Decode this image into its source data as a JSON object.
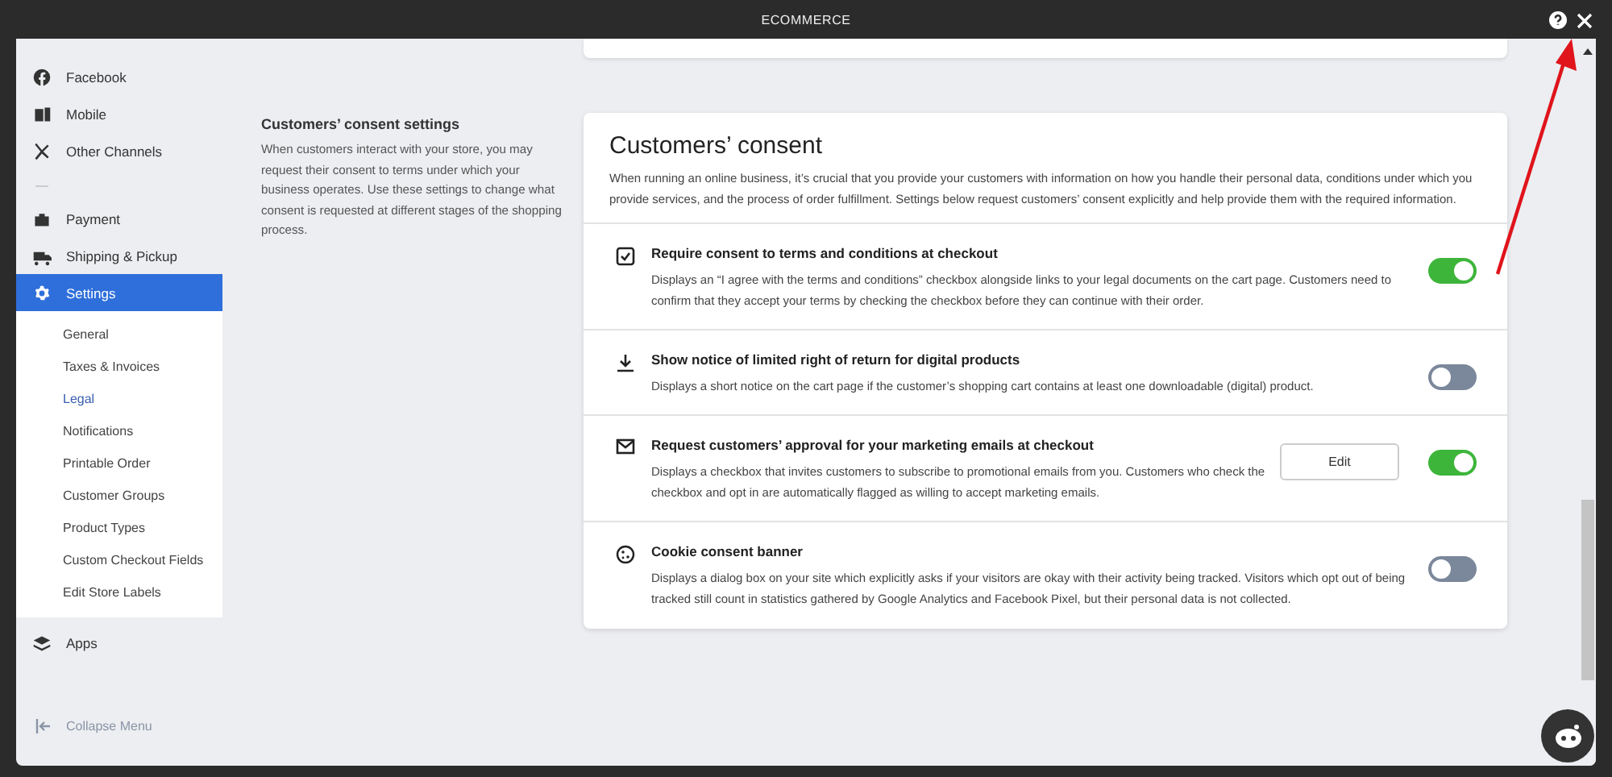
{
  "window": {
    "title": "ECOMMERCE"
  },
  "sidebar": {
    "groups": [
      {
        "items": [
          {
            "label": "Facebook",
            "selected": false
          },
          {
            "label": "Mobile",
            "selected": false
          },
          {
            "label": "Other Channels",
            "selected": false
          }
        ]
      },
      {
        "items": [
          {
            "label": "Payment",
            "selected": false
          },
          {
            "label": "Shipping & Pickup",
            "selected": false
          },
          {
            "label": "Settings",
            "selected": true
          }
        ]
      }
    ],
    "submenu": [
      {
        "label": "General",
        "selected": false
      },
      {
        "label": "Taxes & Invoices",
        "selected": false
      },
      {
        "label": "Legal",
        "selected": true
      },
      {
        "label": "Notifications",
        "selected": false
      },
      {
        "label": "Printable Order",
        "selected": false
      },
      {
        "label": "Customer Groups",
        "selected": false
      },
      {
        "label": "Product Types",
        "selected": false
      },
      {
        "label": "Custom Checkout Fields",
        "selected": false
      },
      {
        "label": "Edit Store Labels",
        "selected": false
      }
    ],
    "bottom_items": [
      {
        "label": "Apps",
        "selected": false
      }
    ],
    "collapse": "Collapse Menu"
  },
  "section": {
    "heading": "Customers’ consent settings",
    "description": "When customers interact with your store, you may request their consent to terms under which your business operates. Use these settings to change what consent is requested at different stages of the shopping process."
  },
  "card": {
    "title": "Customers’ consent",
    "description": "When running an online business, it’s crucial that you provide your customers with information on how you handle their personal data, conditions under which you provide services, and the process of order fulfillment. Settings below request customers’ consent explicitly and help provide them with the required information.",
    "rows": [
      {
        "title": "Require consent to terms and conditions at checkout",
        "description": "Displays an “I agree with the terms and conditions” checkbox alongside links to your legal documents on the cart page. Customers need to confirm that they accept your terms by checking the checkbox before they can continue with their order.",
        "on": true
      },
      {
        "title": "Show notice of limited right of return for digital products",
        "description": "Displays a short notice on the cart page if the customer’s shopping cart contains at least one downloadable (digital) product.",
        "on": false
      },
      {
        "title": "Request customers’ approval for your marketing emails at checkout",
        "description": "Displays a checkbox that invites customers to subscribe to promotional emails from you. Customers who check the checkbox and opt in are automatically flagged as willing to accept marketing emails.",
        "on": true,
        "button": "Edit"
      },
      {
        "title": "Cookie consent banner",
        "description": "Displays a dialog box on your site which explicitly asks if your visitors are okay with their activity being tracked. Visitors which opt out of being tracked still count in statistics gathered by Google Analytics and Facebook Pixel, but their personal data is not collected.",
        "on": false
      }
    ]
  }
}
